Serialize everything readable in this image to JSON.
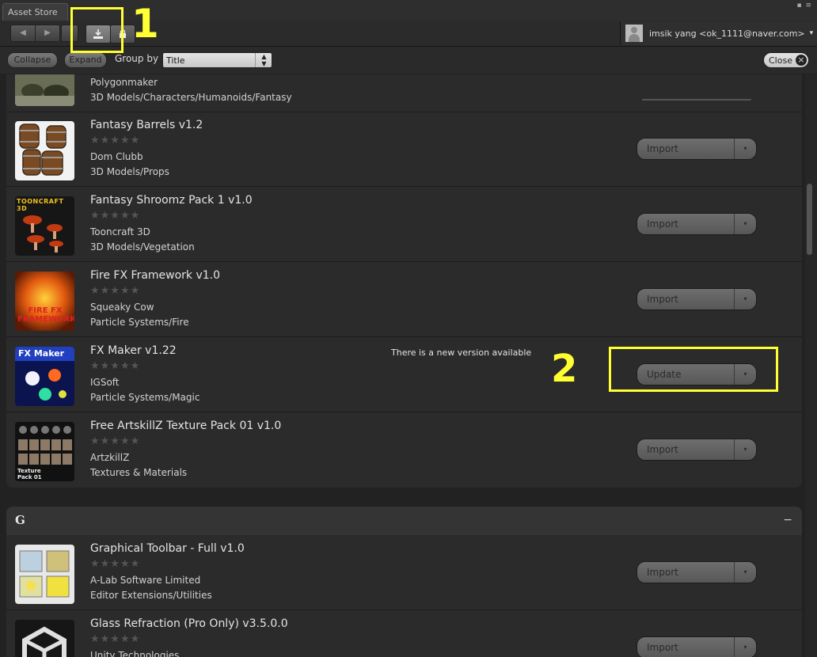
{
  "window": {
    "tab_title": "Asset Store",
    "controls": "▪ ≡"
  },
  "toolbar": {
    "back_icon": "◀",
    "forward_icon": "▶",
    "download_icon": "download-icon",
    "lock_icon": "lock-icon"
  },
  "user": {
    "name": "imsik yang <ok_1111@naver.com>",
    "dropdown": "▾"
  },
  "filter": {
    "collapse_label": "Collapse",
    "expand_label": "Expand",
    "group_by_label": "Group by",
    "group_by_value": "Title",
    "close_label": "Close"
  },
  "products": [
    {
      "name": "",
      "publisher": "Polygonmaker",
      "category": "3D Models/Characters/Humanoids/Fantasy",
      "action": ""
    },
    {
      "name": "Fantasy Barrels v1.2",
      "publisher": "Dom Clubb",
      "category": "3D Models/Props",
      "action": "Import"
    },
    {
      "name": "Fantasy Shroomz Pack 1 v1.0",
      "publisher": "Tooncraft 3D",
      "category": "3D Models/Vegetation",
      "action": "Import"
    },
    {
      "name": "Fire FX Framework v1.0",
      "publisher": "Squeaky Cow",
      "category": "Particle Systems/Fire",
      "action": "Import"
    },
    {
      "name": "FX Maker v1.22",
      "publisher": "IGSoft",
      "category": "Particle Systems/Magic",
      "action": "Update",
      "notice": "There is a new version available"
    },
    {
      "name": "Free ArtskillZ Texture Pack 01 v1.0",
      "publisher": "ArtzkillZ",
      "category": "Textures & Materials",
      "action": "Import"
    }
  ],
  "group_g": {
    "letter": "G",
    "toggle": "−",
    "products": [
      {
        "name": "Graphical Toolbar - Full v1.0",
        "publisher": "A-Lab Software Limited",
        "category": "Editor Extensions/Utilities",
        "action": "Import"
      },
      {
        "name": "Glass Refraction (Pro Only) v3.5.0.0",
        "publisher": "Unity Technologies",
        "category": "",
        "action": "Import"
      }
    ]
  },
  "stars": "★★★★★",
  "dropdown_arrow": "▾",
  "thumbnails": {
    "tooncraft_logo": "TOONCRAFT 3D",
    "fire_fx_logo": "FIRE FX FRAMEWORK",
    "fx_maker_logo": "FX Maker",
    "texture_pack_logo": "Texture Pack 01"
  },
  "annotations": {
    "one": "1",
    "two": "2"
  },
  "colors": {
    "highlight": "#ffff33",
    "background": "#222222",
    "panel": "#2b2b2b"
  }
}
